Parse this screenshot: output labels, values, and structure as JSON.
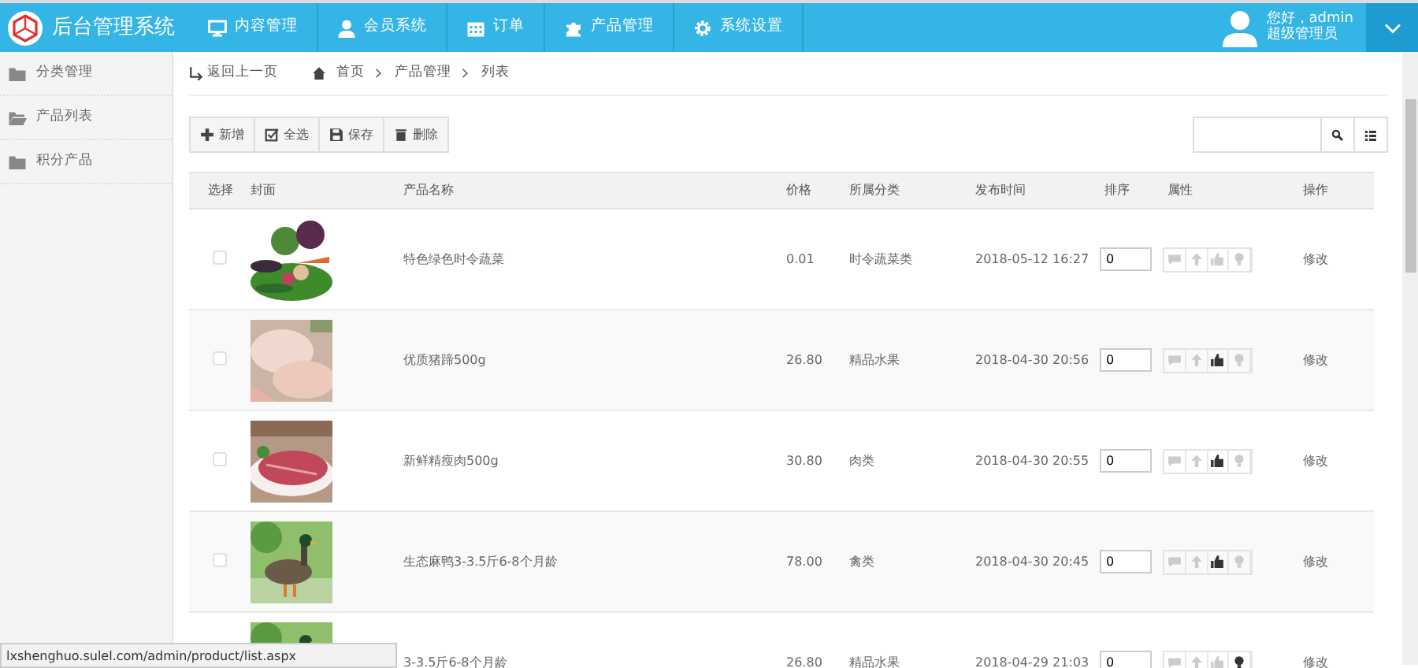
{
  "brand": {
    "title": "后台管理系统"
  },
  "nav": [
    {
      "label": "内容管理"
    },
    {
      "label": "会员系统"
    },
    {
      "label": "订单"
    },
    {
      "label": "产品管理"
    },
    {
      "label": "系统设置"
    }
  ],
  "user": {
    "greeting": "您好，admin",
    "role": "超级管理员"
  },
  "sidebar": {
    "items": [
      {
        "label": "分类管理"
      },
      {
        "label": "产品列表"
      },
      {
        "label": "积分产品"
      }
    ]
  },
  "breadcrumb": {
    "back": "返回上一页",
    "items": [
      "首页",
      "产品管理",
      "列表"
    ]
  },
  "toolbar": [
    {
      "label": "新增"
    },
    {
      "label": "全选"
    },
    {
      "label": "保存"
    },
    {
      "label": "删除"
    }
  ],
  "table": {
    "columns": [
      "选择",
      "封面",
      "产品名称",
      "价格",
      "所属分类",
      "发布时间",
      "排序",
      "属性",
      "操作"
    ],
    "rows": [
      {
        "checked": false,
        "name": "特色绿色时令蔬菜",
        "price": "0.01",
        "category": "时令蔬菜类",
        "date": "2018-05-12 16:27",
        "sort": "0",
        "attributes": [
          false,
          false,
          false,
          false
        ],
        "action": "修改"
      },
      {
        "checked": false,
        "name": "优质猪蹄500g",
        "price": "26.80",
        "category": "精品水果",
        "date": "2018-04-30 20:56",
        "sort": "0",
        "attributes": [
          false,
          false,
          true,
          false
        ],
        "action": "修改"
      },
      {
        "checked": false,
        "name": "新鲜精瘦肉500g",
        "price": "30.80",
        "category": "肉类",
        "date": "2018-04-30 20:55",
        "sort": "0",
        "attributes": [
          false,
          false,
          true,
          false
        ],
        "action": "修改"
      },
      {
        "checked": false,
        "name": "生态麻鸭3-3.5斤6-8个月龄",
        "price": "78.00",
        "category": "禽类",
        "date": "2018-04-30 20:45",
        "sort": "0",
        "attributes": [
          false,
          false,
          true,
          false
        ],
        "action": "修改"
      },
      {
        "name": "3-3.5斤6-8个月龄",
        "price": "26.80",
        "category": "精品水果",
        "date": "2018-04-29 21:03",
        "sort": "0",
        "attributes": [
          false,
          false,
          false,
          true
        ],
        "action": "修改"
      }
    ]
  },
  "status_url": "lxshenghuo.sulel.com/admin/product/list.aspx"
}
